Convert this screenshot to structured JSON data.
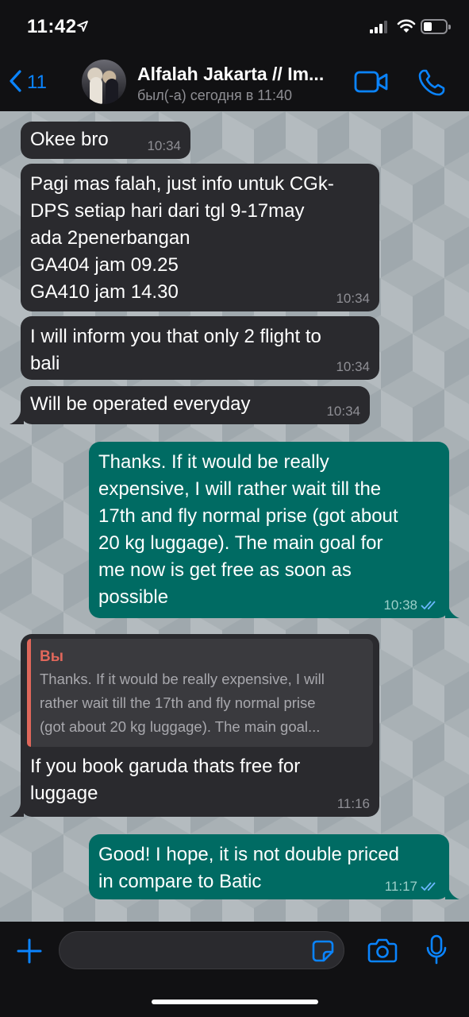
{
  "status_bar": {
    "time": "11:42",
    "icons": [
      "location-arrow-icon",
      "cellular-signal-icon",
      "wifi-icon",
      "battery-icon"
    ]
  },
  "header": {
    "back_count": "11",
    "contact_name": "Alfalah Jakarta // Im...",
    "last_seen": "был(-а) сегодня в 11:40",
    "icons": [
      "chevron-left-icon",
      "video-call-icon",
      "phone-icon"
    ]
  },
  "colors": {
    "accent": "#0a84ff",
    "incoming_bubble": "#2a2a2e",
    "outgoing_bubble": "#006b63",
    "quote_accent": "#e0675b"
  },
  "messages": [
    {
      "direction": "in",
      "lines": [
        "Okee bro"
      ],
      "time": "10:34"
    },
    {
      "direction": "in",
      "lines": [
        "Pagi mas falah, just info untuk CGk-",
        "DPS setiap hari dari tgl 9-17may",
        "ada 2penerbangan",
        "GA404 jam 09.25",
        "GA410 jam 14.30"
      ],
      "time": "10:34"
    },
    {
      "direction": "in",
      "lines": [
        "I will inform you that only 2 flight to",
        "bali"
      ],
      "time": "10:34"
    },
    {
      "direction": "in",
      "lines": [
        "Will be operated everyday"
      ],
      "time": "10:34"
    },
    {
      "direction": "out",
      "lines": [
        "Thanks. If it would be really",
        "expensive, I will rather wait till the",
        "17th and fly normal prise (got about",
        "20 kg luggage). The main goal for",
        "me now is get free as soon as",
        "possible"
      ],
      "time": "10:38",
      "read": true
    },
    {
      "direction": "in",
      "quote": {
        "author": "Вы",
        "lines": [
          "Thanks. If it would be really expensive, I will",
          "rather wait till the 17th and fly normal prise",
          "(got about 20 kg luggage). The main goal..."
        ]
      },
      "lines": [
        "If you book garuda thats free for",
        "luggage"
      ],
      "time": "11:16"
    },
    {
      "direction": "out",
      "lines": [
        "Good! I hope, it is not double priced",
        "in compare to Batic"
      ],
      "time": "11:17",
      "read": true
    }
  ],
  "input": {
    "value": "",
    "placeholder": "",
    "icons": [
      "plus-icon",
      "sticker-icon",
      "camera-icon",
      "microphone-icon"
    ]
  }
}
